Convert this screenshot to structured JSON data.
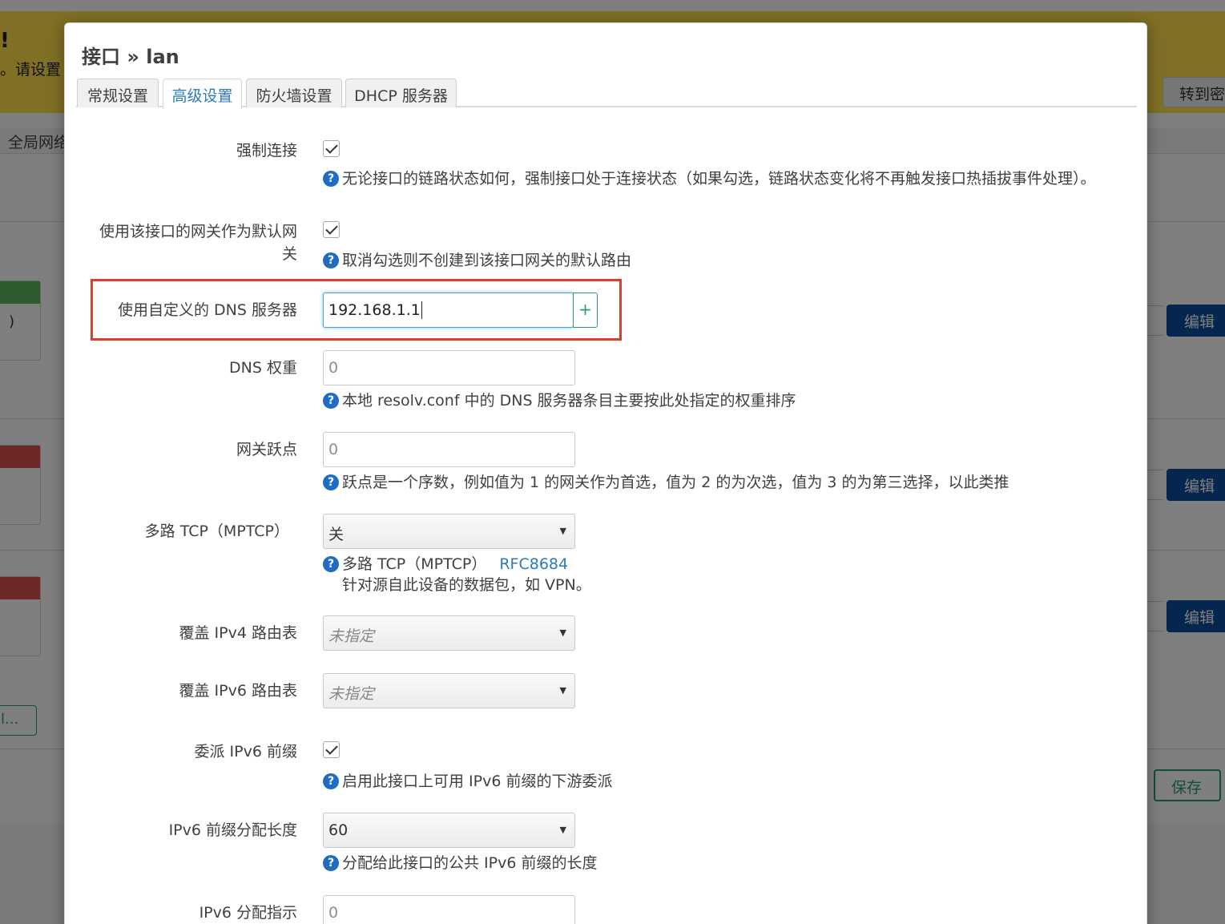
{
  "background": {
    "warning_line1": "!",
    "warning_line2": "。请设置",
    "goto_button": "转到密",
    "global_label": "全局网络",
    "paren": ")",
    "edit_button": "编辑",
    "more_button": "l...",
    "save_button": "保存",
    "colors": {
      "green": "#5cb85c",
      "red": "#d9534f",
      "blue": "#0b4f9e",
      "warning": "#fee14a"
    }
  },
  "modal": {
    "title": "接口 » lan",
    "tabs": [
      "常规设置",
      "高级设置",
      "防火墙设置",
      "DHCP 服务器"
    ],
    "active_tab": 1,
    "fields": {
      "force_link": {
        "label": "强制连接",
        "checked": true,
        "help": "无论接口的链路状态如何，强制接口处于连接状态（如果勾选，链路状态变化将不再触发接口热插拔事件处理）。"
      },
      "default_gateway": {
        "label_line1": "使用该接口的网关作为默认网",
        "label_line2": "关",
        "checked": true,
        "help": "取消勾选则不创建到该接口网关的默认路由"
      },
      "custom_dns": {
        "label": "使用自定义的 DNS 服务器",
        "value": "192.168.1.1",
        "add_label": "+"
      },
      "dns_weight": {
        "label": "DNS 权重",
        "placeholder": "0",
        "help": "本地 resolv.conf 中的 DNS 服务器条目主要按此处指定的权重排序"
      },
      "gateway_metric": {
        "label": "网关跃点",
        "placeholder": "0",
        "help": "跃点是一个序数，例如值为 1 的网关作为首选，值为 2 的为次选，值为 3 的为第三选择，以此类推"
      },
      "mptcp": {
        "label": "多路 TCP（MPTCP）",
        "value": "关",
        "help_line1": "多路 TCP（MPTCP）",
        "help_link": "RFC8684",
        "help_line2": "针对源自此设备的数据包，如 VPN。"
      },
      "ipv4_table": {
        "label": "覆盖 IPv4 路由表",
        "value": "未指定"
      },
      "ipv6_table": {
        "label": "覆盖 IPv6 路由表",
        "value": "未指定"
      },
      "delegate_ipv6": {
        "label": "委派 IPv6 前缀",
        "checked": true,
        "help": "启用此接口上可用 IPv6 前缀的下游委派"
      },
      "ipv6_assign_length": {
        "label": "IPv6 前缀分配长度",
        "value": "60",
        "help": "分配给此接口的公共 IPv6 前缀的长度"
      },
      "ipv6_hint": {
        "label": "IPv6 分配指示",
        "placeholder": "0"
      }
    }
  }
}
